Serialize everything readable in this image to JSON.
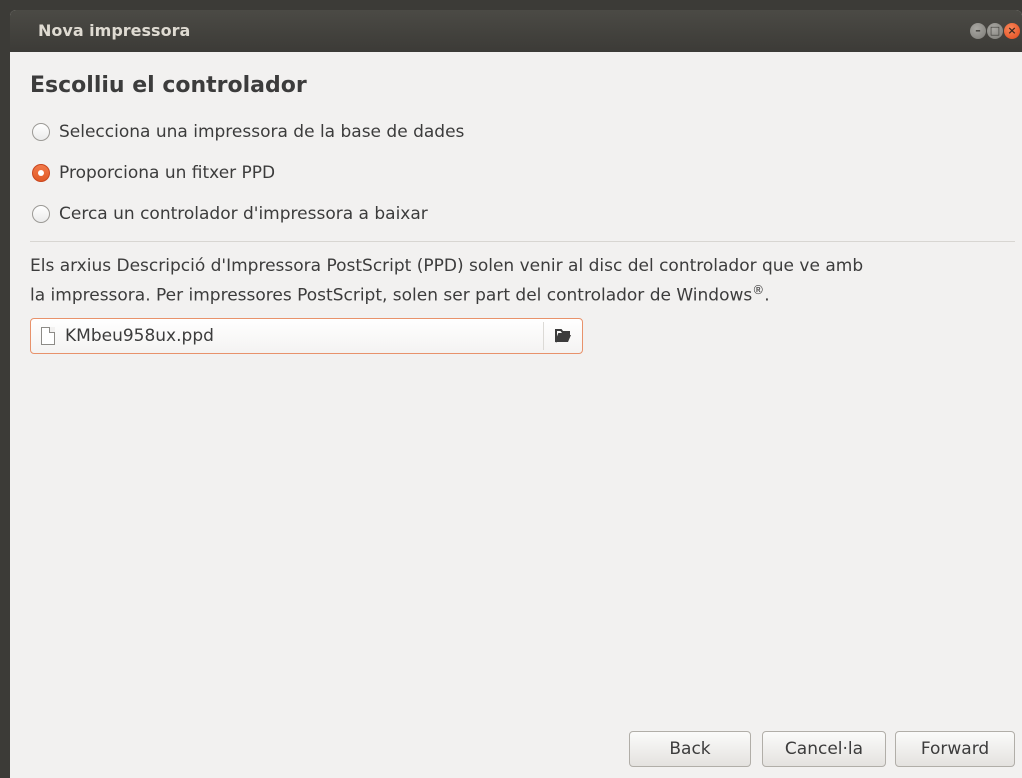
{
  "window": {
    "title": "Nova impressora"
  },
  "page": {
    "heading": "Escolliu el controlador"
  },
  "options": [
    {
      "label": "Selecciona una impressora de la base de dades",
      "checked": false
    },
    {
      "label": "Proporciona un fitxer PPD",
      "checked": true
    },
    {
      "label": "Cerca un controlador d'impressora a baixar",
      "checked": false
    }
  ],
  "description": {
    "line1": "Els arxius Descripció d'Impressora PostScript (PPD) solen venir al disc del controlador que ve amb",
    "line2": "la impressora. Per impressores PostScript, solen ser part del controlador de Windows",
    "registered": "®",
    "end": "."
  },
  "file_chooser": {
    "value": "KMbeu958ux.ppd"
  },
  "buttons": {
    "back": "Back",
    "cancel": "Cancel·la",
    "forward": "Forward"
  },
  "colors": {
    "accent": "#e25a26",
    "titlebar": "#3c3b37",
    "window_bg": "#f2f1f0"
  }
}
